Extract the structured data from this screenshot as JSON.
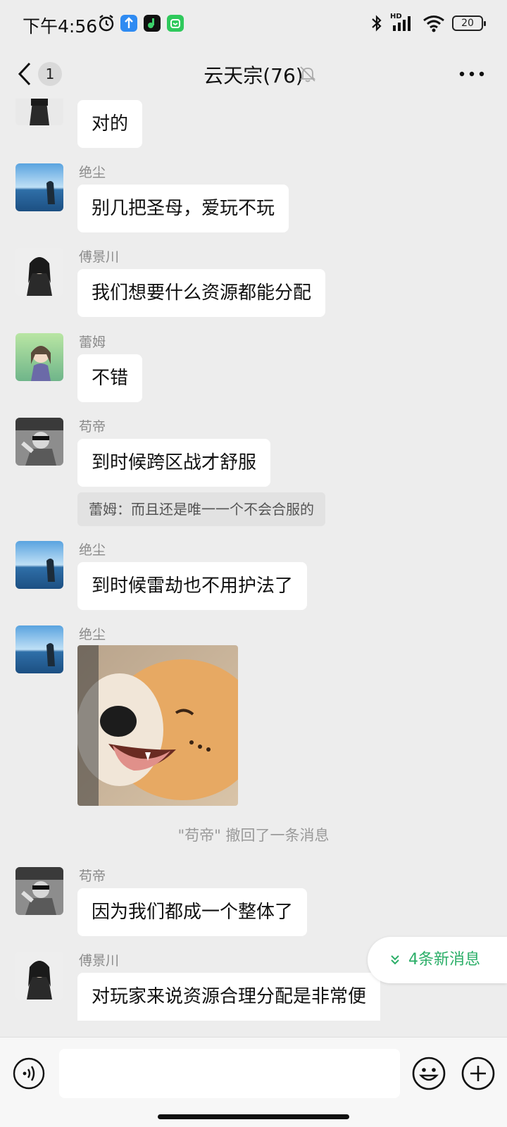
{
  "status_bar": {
    "time": "下午4:56",
    "network": "HD",
    "battery": "20"
  },
  "header": {
    "unread_count": "1",
    "title": "云天宗(76)"
  },
  "messages": [
    {
      "sender": "",
      "text": "对的"
    },
    {
      "sender": "绝尘",
      "text": "别几把圣母，爱玩不玩"
    },
    {
      "sender": "傅景川",
      "text": "我们想要什么资源都能分配"
    },
    {
      "sender": "蕾姆",
      "text": "不错"
    },
    {
      "sender": "苟帝",
      "text": "到时候跨区战才舒服",
      "quote": "蕾姆：而且还是唯一一个不会合服的"
    },
    {
      "sender": "绝尘",
      "text": "到时候雷劫也不用护法了"
    },
    {
      "sender": "绝尘",
      "sticker": "smiling-shiba-dog"
    },
    {
      "system": "\"苟帝\" 撤回了一条消息"
    },
    {
      "sender": "苟帝",
      "text": "因为我们都成一个整体了"
    },
    {
      "sender": "傅景川",
      "text": "对玩家来说资源合理分配是非常便"
    }
  ],
  "new_messages_label": "4条新消息",
  "input": {
    "value": "",
    "placeholder": ""
  },
  "colors": {
    "background": "#ededed",
    "bubble": "#ffffff",
    "accent_green": "#2aae67",
    "system_text": "#9a9a9a"
  }
}
